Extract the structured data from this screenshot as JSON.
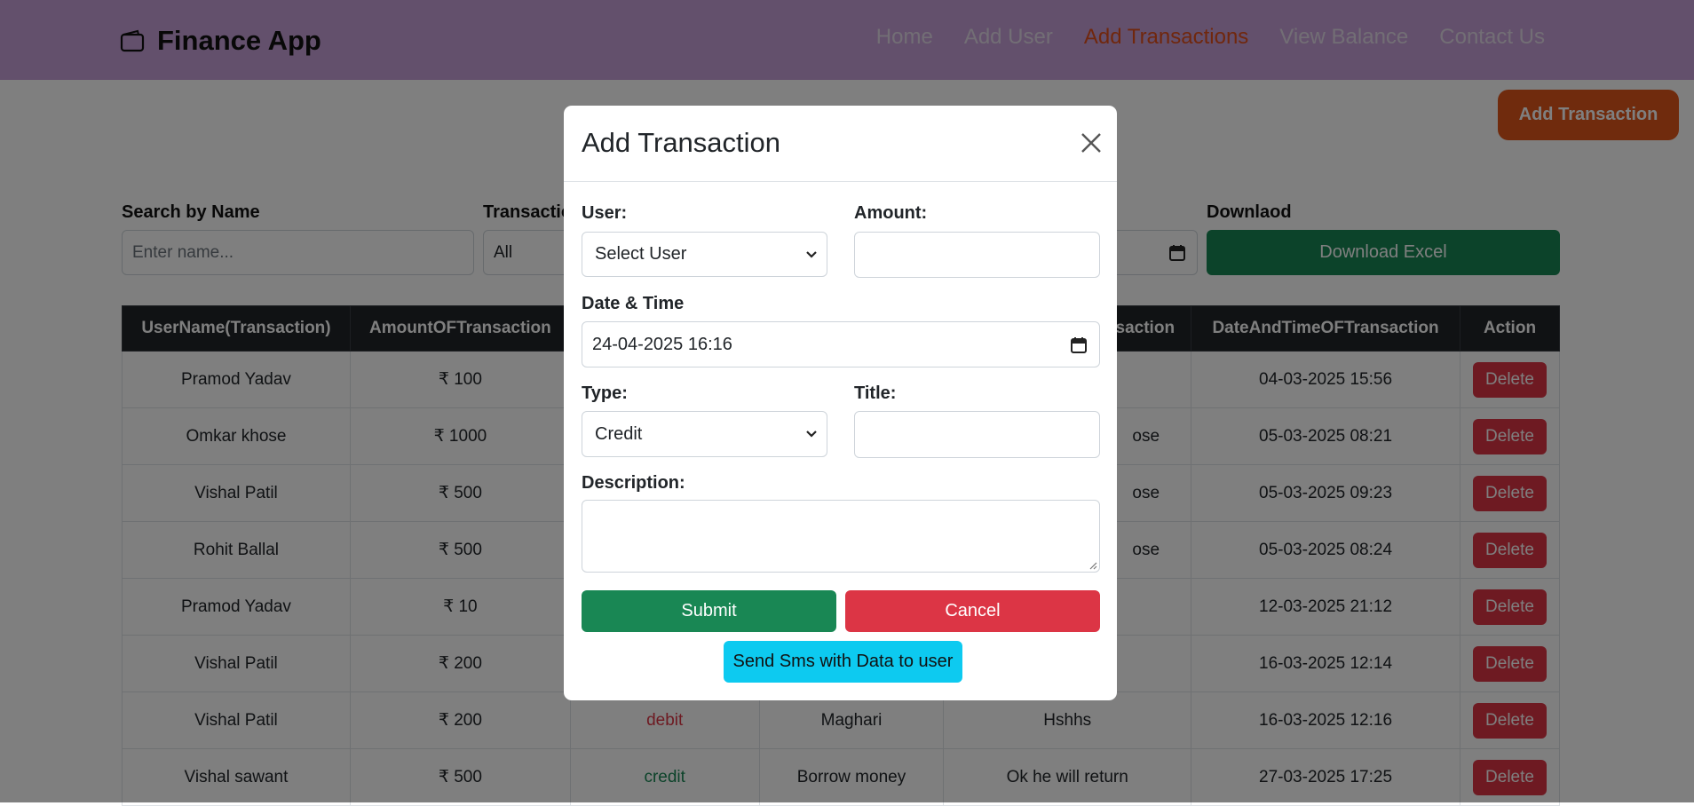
{
  "navbar": {
    "brand_icon": "wallet-icon",
    "brand": "Finance App",
    "links": [
      "Home",
      "Add User",
      "Add Transactions",
      "View Balance",
      "Contact Us"
    ],
    "active_link": "Add Transactions",
    "background": "#c7a1d8",
    "active_color": "#e04e1b"
  },
  "toolbar": {
    "add_transaction": "Add Transaction"
  },
  "filters": {
    "search_label": "Search by Name",
    "search_placeholder": "Enter name...",
    "type_label": "Transactio",
    "type_value": "All",
    "download_label": "Downlaod",
    "download_button": "Download Excel",
    "calendar_icon": "calendar-icon"
  },
  "table": {
    "headers": [
      "UserName(Transaction)",
      "AmountOFTransaction",
      "",
      "",
      "saction",
      "DateAndTimeOFTransaction",
      "Action"
    ],
    "rows": [
      {
        "name": "Pramod Yadav",
        "amount": "₹ 100",
        "type": "",
        "title": "",
        "desc": "",
        "datetime": "04-03-2025 15:56"
      },
      {
        "name": "Omkar khose",
        "amount": "₹ 1000",
        "type": "",
        "title": "",
        "desc": "ose",
        "datetime": "05-03-2025 08:21"
      },
      {
        "name": "Vishal Patil",
        "amount": "₹ 500",
        "type": "",
        "title": "",
        "desc": "ose",
        "datetime": "05-03-2025 09:23"
      },
      {
        "name": "Rohit Ballal",
        "amount": "₹ 500",
        "type": "",
        "title": "",
        "desc": "ose",
        "datetime": "05-03-2025 08:24"
      },
      {
        "name": "Pramod Yadav",
        "amount": "₹ 10",
        "type": "",
        "title": "",
        "desc": "",
        "datetime": "12-03-2025 21:12"
      },
      {
        "name": "Vishal Patil",
        "amount": "₹ 200",
        "type": "",
        "title": "",
        "desc": "",
        "datetime": "16-03-2025 12:14"
      },
      {
        "name": "Vishal Patil",
        "amount": "₹ 200",
        "type": "debit",
        "title": "Maghari",
        "desc": "Hshhs",
        "datetime": "16-03-2025 12:16"
      },
      {
        "name": "Vishal sawant",
        "amount": "₹ 500",
        "type": "credit",
        "title": "Borrow money",
        "desc": "Ok he will return",
        "datetime": "27-03-2025 17:25"
      }
    ],
    "delete_label": "Delete",
    "credit_color": "#198754",
    "debit_color": "#dc3545"
  },
  "modal": {
    "title": "Add Transaction",
    "close_icon": "close-icon",
    "user_label": "User:",
    "user_value": "Select User",
    "amount_label": "Amount:",
    "amount_value": "",
    "datetime_label": "Date & Time",
    "datetime_value": "24-04-2025 16:16",
    "type_label": "Type:",
    "type_value": "Credit",
    "title_label": "Title:",
    "title_value": "",
    "description_label": "Description:",
    "description_value": "",
    "submit": "Submit",
    "cancel": "Cancel",
    "send_sms": "Send Sms with Data to user",
    "submit_color": "#198754",
    "cancel_color": "#dc3545",
    "sms_color": "#0dcaf0"
  }
}
